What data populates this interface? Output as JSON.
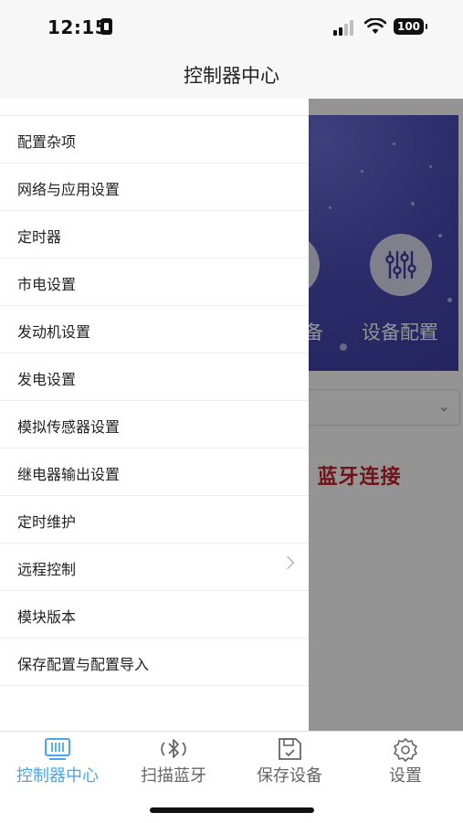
{
  "status_bar": {
    "time": "12:15",
    "battery": "100"
  },
  "header": {
    "title": "控制器中心"
  },
  "background": {
    "banner_labels": [
      "备",
      "设备配置"
    ],
    "bluetooth_status": "蓝牙连接"
  },
  "drawer": {
    "items": [
      {
        "label": "配置杂项"
      },
      {
        "label": "网络与应用设置"
      },
      {
        "label": "定时器"
      },
      {
        "label": "市电设置"
      },
      {
        "label": "发动机设置"
      },
      {
        "label": "发电设置"
      },
      {
        "label": "模拟传感器设置"
      },
      {
        "label": "继电器输出设置"
      },
      {
        "label": "定时维护"
      },
      {
        "label": "远程控制",
        "has_submenu": true
      },
      {
        "label": "模块版本"
      },
      {
        "label": "保存配置与配置导入"
      }
    ]
  },
  "tabbar": {
    "active_color": "#4aa6e8",
    "tabs": [
      {
        "label": "控制器中心",
        "icon": "controller-icon",
        "active": true
      },
      {
        "label": "扫描蓝牙",
        "icon": "bluetooth-scan-icon",
        "active": false
      },
      {
        "label": "保存设备",
        "icon": "save-device-icon",
        "active": false
      },
      {
        "label": "设置",
        "icon": "settings-gear-icon",
        "active": false
      }
    ]
  }
}
